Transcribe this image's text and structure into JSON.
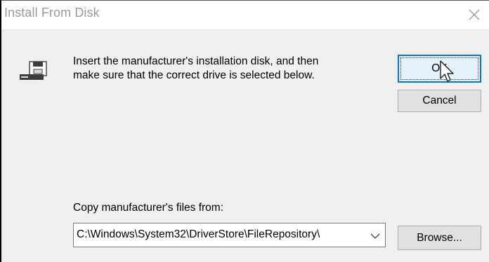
{
  "window": {
    "title": "Install From Disk"
  },
  "icons": {
    "close": "close-icon",
    "disk": "floppy-drive-icon",
    "dropdown": "chevron-down-icon",
    "cursor": "mouse-pointer-icon"
  },
  "prompt": {
    "line1": "Insert the manufacturer's installation disk, and then",
    "line2": "make sure that the correct drive is selected below."
  },
  "buttons": {
    "ok_label": "OK",
    "cancel_label": "Cancel",
    "browse_label": "Browse..."
  },
  "copy_from": {
    "label": "Copy manufacturer's files from:",
    "value": "C:\\Windows\\System32\\DriverStore\\FileRepository\\"
  },
  "colors": {
    "dialog_bg": "#f0f0f0",
    "titlebar_bg": "#ffffff",
    "default_button_border": "#0078d7",
    "button_bg": "#e1e1e1"
  }
}
